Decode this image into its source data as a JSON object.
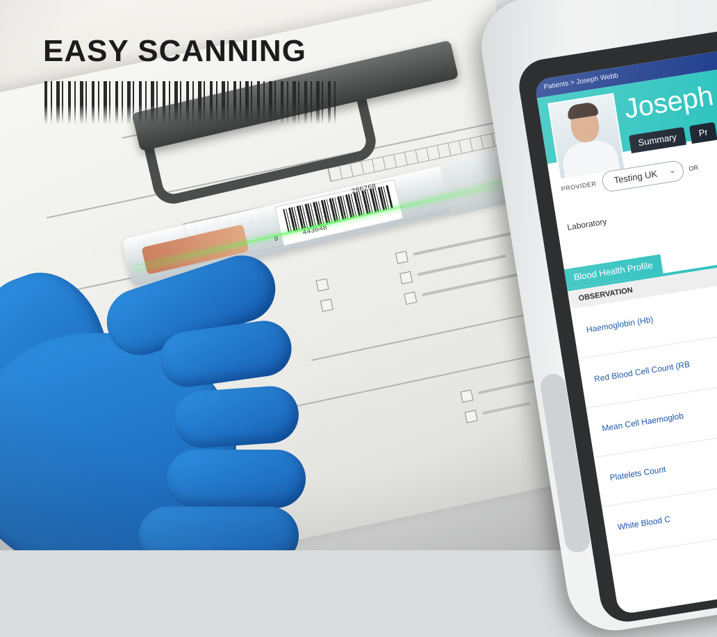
{
  "headline": "EASY SCANNING",
  "tube_label": {
    "left_digit": "9",
    "number_main": "443648",
    "number_top": "286268"
  },
  "tablet": {
    "breadcrumb": "Patients > Joseph Webb",
    "patient_name": "Joseph W",
    "tabs": [
      {
        "label": "Summary"
      },
      {
        "label": "Pr"
      }
    ],
    "provider_label": "PROVIDER",
    "provider_value": "Testing UK",
    "provider_extra": "OR",
    "lab_label": "Laboratory",
    "section_tab": "Blood Health Profile",
    "observation_header": "OBSERVATION",
    "observations": [
      {
        "label": "Haemoglobin (Hb)"
      },
      {
        "label": "Red Blood Cell Count (RB"
      },
      {
        "label": "Mean Cell Haemoglob"
      },
      {
        "label": "Platelets Count"
      },
      {
        "label": "White Blood C"
      }
    ]
  },
  "colors": {
    "accent_teal": "#2fc4bf",
    "nav_blue": "#1f3d8c",
    "link_blue": "#1f57a8",
    "glove_blue": "#1f78d1"
  }
}
